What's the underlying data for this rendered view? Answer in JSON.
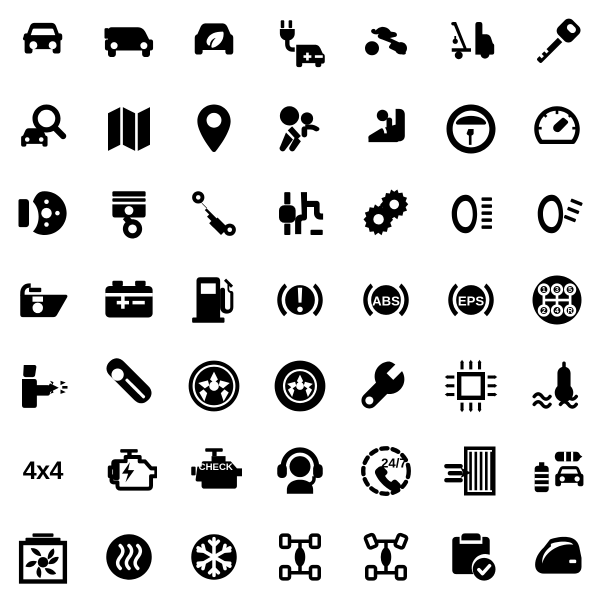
{
  "sheet": {
    "title": "Automotive Icon Set",
    "background_color": "#ffffff",
    "icon_color": "#000000",
    "columns": 7,
    "rows": 7,
    "total_icons": 49,
    "canvas": "600x600"
  },
  "icons": [
    {
      "index": 1,
      "row": 1,
      "col": 1,
      "name": "car-front-icon",
      "label": "Car front view"
    },
    {
      "index": 2,
      "row": 1,
      "col": 2,
      "name": "electric-car-plug-icon",
      "label": "Electric car with plug"
    },
    {
      "index": 3,
      "row": 1,
      "col": 3,
      "name": "eco-car-leaf-icon",
      "label": "Eco car with leaf"
    },
    {
      "index": 4,
      "row": 1,
      "col": 4,
      "name": "car-charging-icon",
      "label": "Car charging plug"
    },
    {
      "index": 5,
      "row": 1,
      "col": 5,
      "name": "motorcycle-icon",
      "label": "Motorcycle"
    },
    {
      "index": 6,
      "row": 1,
      "col": 6,
      "name": "tow-truck-icon",
      "label": "Tow truck"
    },
    {
      "index": 7,
      "row": 1,
      "col": 7,
      "name": "car-key-icon",
      "label": "Car key"
    },
    {
      "index": 8,
      "row": 2,
      "col": 1,
      "name": "car-search-icon",
      "label": "Car search / inspection"
    },
    {
      "index": 9,
      "row": 2,
      "col": 2,
      "name": "map-icon",
      "label": "Folded map"
    },
    {
      "index": 10,
      "row": 2,
      "col": 3,
      "name": "map-pin-icon",
      "label": "Location pin"
    },
    {
      "index": 11,
      "row": 2,
      "col": 4,
      "name": "airbag-icon",
      "label": "Airbag deployment"
    },
    {
      "index": 12,
      "row": 2,
      "col": 5,
      "name": "child-car-seat-icon",
      "label": "Child car seat"
    },
    {
      "index": 13,
      "row": 2,
      "col": 6,
      "name": "steering-wheel-icon",
      "label": "Steering wheel"
    },
    {
      "index": 14,
      "row": 2,
      "col": 7,
      "name": "speedometer-icon",
      "label": "Speedometer"
    },
    {
      "index": 15,
      "row": 3,
      "col": 1,
      "name": "brake-disc-icon",
      "label": "Brake disc and caliper"
    },
    {
      "index": 16,
      "row": 3,
      "col": 2,
      "name": "piston-icon",
      "label": "Engine piston"
    },
    {
      "index": 17,
      "row": 3,
      "col": 3,
      "name": "shock-absorber-icon",
      "label": "Shock absorber"
    },
    {
      "index": 18,
      "row": 3,
      "col": 4,
      "name": "crankshaft-exhaust-icon",
      "label": "Crankshaft exhaust pipe"
    },
    {
      "index": 19,
      "row": 3,
      "col": 5,
      "name": "gears-icon",
      "label": "Gears / settings"
    },
    {
      "index": 20,
      "row": 3,
      "col": 6,
      "name": "low-beam-headlight-icon",
      "label": "Low beam headlight"
    },
    {
      "index": 21,
      "row": 3,
      "col": 7,
      "name": "high-beam-headlight-icon",
      "label": "High beam headlight"
    },
    {
      "index": 22,
      "row": 4,
      "col": 1,
      "name": "oil-can-icon",
      "label": "Oil can with drop"
    },
    {
      "index": 23,
      "row": 4,
      "col": 2,
      "name": "car-battery-icon",
      "label": "Car battery"
    },
    {
      "index": 24,
      "row": 4,
      "col": 3,
      "name": "fuel-pump-icon",
      "label": "Fuel pump"
    },
    {
      "index": 25,
      "row": 4,
      "col": 4,
      "name": "brake-warning-icon",
      "label": "Brake warning light"
    },
    {
      "index": 26,
      "row": 4,
      "col": 5,
      "name": "abs-warning-icon",
      "label": "ABS warning light",
      "text": "ABS"
    },
    {
      "index": 27,
      "row": 4,
      "col": 6,
      "name": "eps-warning-icon",
      "label": "EPS warning light",
      "text": "EPS"
    },
    {
      "index": 28,
      "row": 4,
      "col": 7,
      "name": "gear-shift-pattern-icon",
      "label": "Manual gear shift pattern",
      "gears": [
        "1",
        "3",
        "5",
        "2",
        "4",
        "R"
      ]
    },
    {
      "index": 29,
      "row": 5,
      "col": 1,
      "name": "spray-gun-icon",
      "label": "Paint spray gun"
    },
    {
      "index": 30,
      "row": 5,
      "col": 2,
      "name": "spark-plug-icon",
      "label": "Spark plug"
    },
    {
      "index": 31,
      "row": 5,
      "col": 3,
      "name": "alloy-wheel-icon",
      "label": "Alloy wheel rim"
    },
    {
      "index": 32,
      "row": 5,
      "col": 4,
      "name": "tire-wheel-icon",
      "label": "Tire with rim"
    },
    {
      "index": 33,
      "row": 5,
      "col": 5,
      "name": "wrench-icon",
      "label": "Wrench"
    },
    {
      "index": 34,
      "row": 5,
      "col": 6,
      "name": "ecu-chip-icon",
      "label": "ECU microchip"
    },
    {
      "index": 35,
      "row": 5,
      "col": 7,
      "name": "coolant-temperature-icon",
      "label": "Coolant temperature"
    },
    {
      "index": 36,
      "row": 6,
      "col": 1,
      "name": "four-by-four-text-icon",
      "label": "Four wheel drive",
      "text": "4x4"
    },
    {
      "index": 37,
      "row": 6,
      "col": 2,
      "name": "engine-power-icon",
      "label": "Engine with lightning bolt"
    },
    {
      "index": 38,
      "row": 6,
      "col": 3,
      "name": "check-engine-icon",
      "label": "Check engine light",
      "text": "CHECK"
    },
    {
      "index": 39,
      "row": 6,
      "col": 4,
      "name": "support-headset-icon",
      "label": "Customer support agent"
    },
    {
      "index": 40,
      "row": 6,
      "col": 5,
      "name": "twenty-four-seven-icon",
      "label": "24/7 phone support",
      "text": "24/7"
    },
    {
      "index": 41,
      "row": 6,
      "col": 6,
      "name": "air-filter-icon",
      "label": "Air filter airflow"
    },
    {
      "index": 42,
      "row": 6,
      "col": 7,
      "name": "exhaust-muffler-car-icon",
      "label": "Exhaust muffler and car"
    },
    {
      "index": 43,
      "row": 7,
      "col": 1,
      "name": "radiator-fan-icon",
      "label": "Radiator with fan"
    },
    {
      "index": 44,
      "row": 7,
      "col": 2,
      "name": "seat-heater-icon",
      "label": "Heating / hot air"
    },
    {
      "index": 45,
      "row": 7,
      "col": 3,
      "name": "air-conditioning-icon",
      "label": "Air conditioning snowflake"
    },
    {
      "index": 46,
      "row": 7,
      "col": 4,
      "name": "chassis-rear-axle-icon",
      "label": "Chassis straight wheels"
    },
    {
      "index": 47,
      "row": 7,
      "col": 5,
      "name": "wheel-alignment-icon",
      "label": "Wheel alignment angled"
    },
    {
      "index": 48,
      "row": 7,
      "col": 6,
      "name": "inspection-checklist-icon",
      "label": "Inspection clipboard check"
    },
    {
      "index": 49,
      "row": 7,
      "col": 7,
      "name": "car-door-icon",
      "label": "Car door"
    }
  ]
}
